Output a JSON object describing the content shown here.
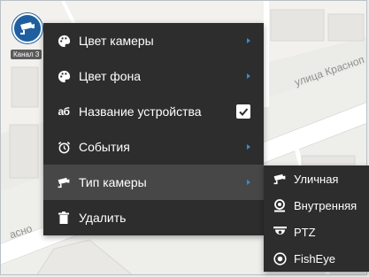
{
  "map": {
    "street_labels": [
      "улица Красноп",
      "асно"
    ]
  },
  "marker": {
    "label": "Канал 3",
    "icon": "camera-icon",
    "color": "#1f5f9f"
  },
  "context_menu": {
    "items": [
      {
        "label": "Цвет камеры",
        "icon": "palette-icon",
        "has_submenu": true
      },
      {
        "label": "Цвет фона",
        "icon": "palette-icon",
        "has_submenu": true
      },
      {
        "label": "Название устройства",
        "icon": "аб",
        "checked": true
      },
      {
        "label": "События",
        "icon": "alarm-clock-icon",
        "has_submenu": true
      },
      {
        "label": "Тип камеры",
        "icon": "camera-icon",
        "has_submenu": true,
        "active": true
      },
      {
        "label": "Удалить",
        "icon": "trash-icon"
      }
    ]
  },
  "camera_type_submenu": {
    "items": [
      {
        "label": "Уличная",
        "icon": "street-camera-icon"
      },
      {
        "label": "Внутренняя",
        "icon": "dome-camera-icon"
      },
      {
        "label": "PTZ",
        "icon": "ptz-camera-icon"
      },
      {
        "label": "FishEye",
        "icon": "fisheye-camera-icon"
      }
    ]
  },
  "colors": {
    "menu_bg": "#2d2d2d",
    "menu_active": "#474747",
    "arrow_accent": "#2f8de4"
  }
}
